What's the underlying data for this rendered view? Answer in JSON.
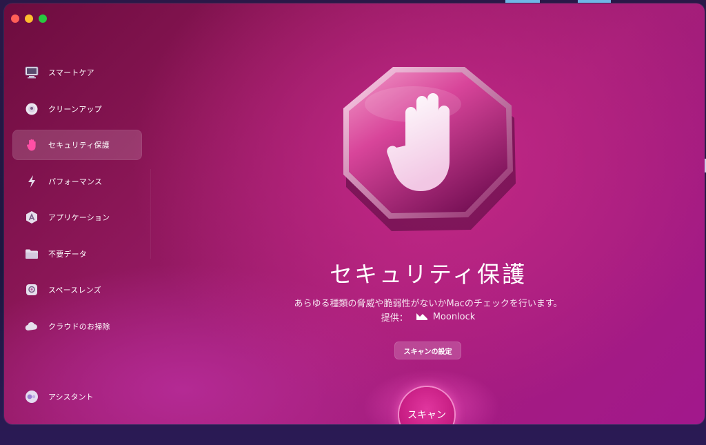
{
  "sidebar": {
    "items": [
      {
        "id": "smart-care",
        "label": "スマートケア",
        "icon": "monitor-icon"
      },
      {
        "id": "cleanup",
        "label": "クリーンアップ",
        "icon": "cleanup-disc-icon"
      },
      {
        "id": "protection",
        "label": "セキュリティ保護",
        "icon": "hand-stop-icon",
        "active": true
      },
      {
        "id": "performance",
        "label": "パフォーマンス",
        "icon": "lightning-icon"
      },
      {
        "id": "applications",
        "label": "アプリケーション",
        "icon": "applications-icon"
      },
      {
        "id": "clutter",
        "label": "不要データ",
        "icon": "folder-icon"
      },
      {
        "id": "space-lens",
        "label": "スペースレンズ",
        "icon": "lens-icon"
      },
      {
        "id": "cloud-cleanup",
        "label": "クラウドのお掃除",
        "icon": "cloud-icon"
      }
    ],
    "assistant": {
      "label": "アシスタント",
      "icon": "assistant-icon"
    }
  },
  "main": {
    "title": "セキュリティ保護",
    "description": "あらゆる種類の脅威や脆弱性がないかMacのチェックを行います。",
    "provider_prefix": "提供：",
    "provider_name": "Moonlock",
    "settings_button": "スキャンの設定",
    "scan_button": "スキャン"
  },
  "colors": {
    "accent": "#c81e84",
    "background_dark": "#6d0c3e",
    "background_light": "#a2188c"
  }
}
